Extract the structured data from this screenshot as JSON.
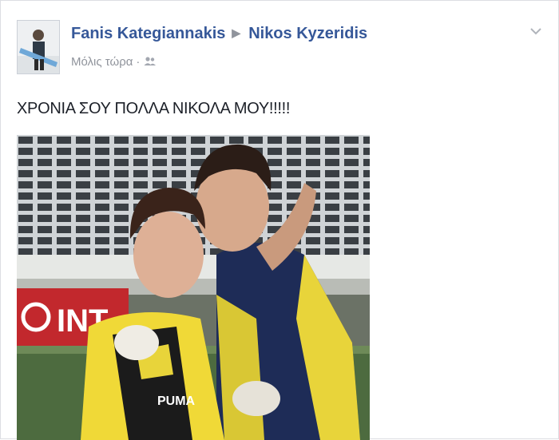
{
  "post": {
    "author": "Fanis Kategiannakis",
    "recipient": "Nikos Kyzeridis",
    "timestamp": "Μόλις τώρα",
    "separator": "·",
    "audience_icon": "friends-icon",
    "options_icon": "chevron-down-icon",
    "text": "ΧΡΟΝΙΑ ΣΟΥ ΠΟΛΛΑ ΝΙΚΟΛΑ ΜΟΥ!!!!!",
    "photo": {
      "banner_text": "INT",
      "jersey_text": "PUMA"
    }
  },
  "colors": {
    "name_link": "#365899",
    "meta_text": "#90949c",
    "body_text": "#1d2129"
  }
}
